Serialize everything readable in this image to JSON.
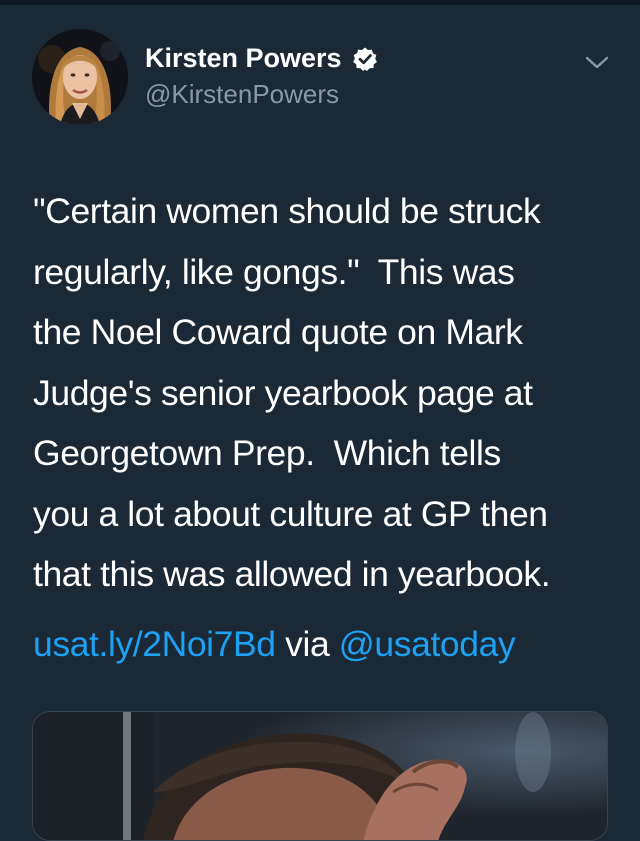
{
  "tweet": {
    "author": {
      "name": "Kirsten Powers",
      "handle": "@KirstenPowers",
      "verified": true
    },
    "text_lines": [
      "\"Certain women should be struck",
      "regularly, like gongs.\"  This was",
      "the Noel Coward quote on Mark",
      "Judge's senior yearbook page at",
      "Georgetown Prep.  Which tells",
      "you a lot about culture at GP then",
      "that this was allowed in yearbook."
    ],
    "link": {
      "url_text": "usat.ly/2Noi7Bd",
      "via": "via",
      "mention": "@usatoday"
    },
    "media": {
      "icon": "photo-thumbnail"
    }
  },
  "icons": {
    "verified": "verified-badge-icon",
    "more": "chevron-down-icon"
  },
  "colors": {
    "background": "#1b2836",
    "link": "#1da1f2",
    "secondary_text": "#8899a6",
    "primary_text": "#ffffff"
  }
}
